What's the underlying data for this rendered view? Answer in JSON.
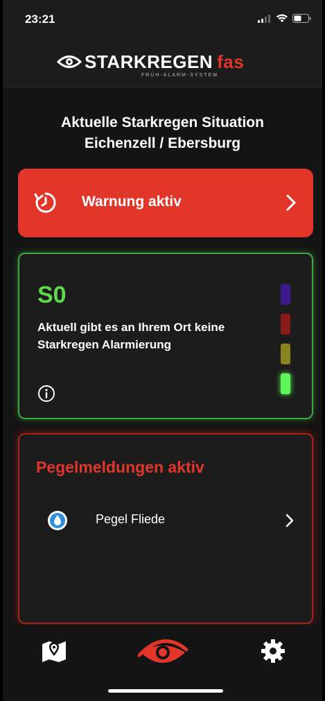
{
  "status_bar": {
    "time": "23:21"
  },
  "header": {
    "logo_text": "STARKREGEN",
    "logo_accent": "fas",
    "logo_subtitle": "FRÜH-ALARM-SYSTEM"
  },
  "title": {
    "line1": "Aktuelle Starkregen Situation",
    "line2": "Eichenzell / Ebersburg"
  },
  "warning": {
    "label": "Warnung aktiv",
    "color": "#e3362b"
  },
  "status_card": {
    "level_code": "S0",
    "message": "Aktuell gibt es an Ihrem Ort keine Starkregen Alarmierung",
    "levels": [
      {
        "color": "#3d1a8c",
        "active": false
      },
      {
        "color": "#8a1b1b",
        "active": false
      },
      {
        "color": "#8a8420",
        "active": false
      },
      {
        "color": "#5ef55a",
        "active": true
      }
    ]
  },
  "gauge_card": {
    "title": "Pegelmeldungen aktiv",
    "items": [
      {
        "name": "Pegel Fliede"
      }
    ]
  },
  "tab_bar": {
    "tabs": [
      {
        "icon": "map-pin-icon"
      },
      {
        "icon": "eye-icon",
        "active": true
      },
      {
        "icon": "gear-icon"
      }
    ]
  }
}
